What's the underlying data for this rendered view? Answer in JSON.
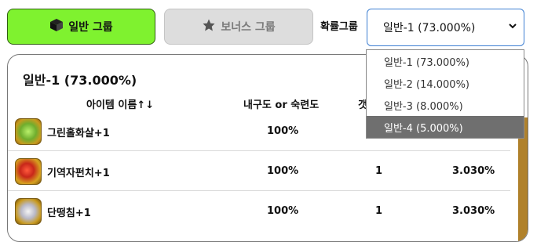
{
  "tabs": {
    "general_label": "일반 그룹",
    "bonus_label": "보너스 그룹"
  },
  "select": {
    "label": "확률그룹",
    "value": "일반-1 (73.000%)",
    "options": [
      "일반-1 (73.000%)",
      "일반-2 (14.000%)",
      "일반-3 (8.000%)",
      "일반-4 (5.000%)"
    ],
    "highlighted_index": 3
  },
  "panel": {
    "title": "일반-1 (73.000%)",
    "headers": {
      "name": "아이템 이름↑↓",
      "durability": "내구도 or 숙련도",
      "count": "갯"
    },
    "rows": [
      {
        "icon": "green-gem-icon",
        "name": "그린홀화살+1",
        "durability": "100%",
        "count": "",
        "prob": ""
      },
      {
        "icon": "red-gem-icon",
        "name": "기역자펀치+1",
        "durability": "100%",
        "count": "1",
        "prob": "3.030%"
      },
      {
        "icon": "claw-icon",
        "name": "단떵침+1",
        "durability": "100%",
        "count": "1",
        "prob": "3.030%"
      }
    ]
  },
  "colors": {
    "general_tab": "#7ff22f",
    "bonus_tab": "#dddddd",
    "select_border": "#3d7fd2",
    "highlight": "#6f6f6f",
    "scrollbar": "#b0812b"
  }
}
